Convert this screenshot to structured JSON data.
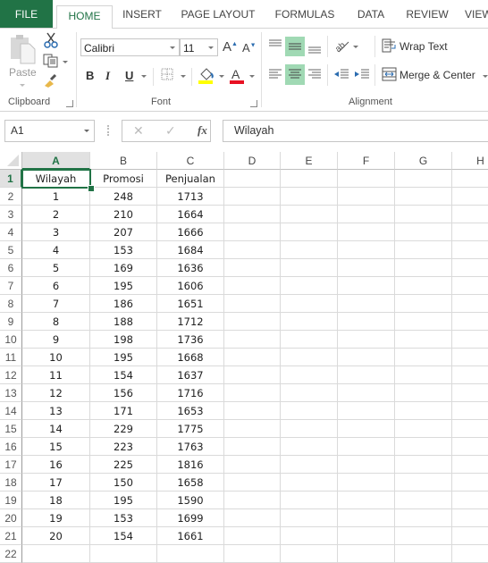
{
  "tabs": [
    {
      "label": "FILE"
    },
    {
      "label": "HOME"
    },
    {
      "label": "INSERT"
    },
    {
      "label": "PAGE LAYOUT"
    },
    {
      "label": "FORMULAS"
    },
    {
      "label": "DATA"
    },
    {
      "label": "REVIEW"
    },
    {
      "label": "VIEW"
    }
  ],
  "ribbon": {
    "clipboard": {
      "label": "Clipboard",
      "paste_label": "Paste"
    },
    "font": {
      "label": "Font",
      "font_name": "Calibri",
      "font_size": "11",
      "bold": "B",
      "italic": "I",
      "underline": "U",
      "fill_color": "#ffff00",
      "font_color": "#e81123"
    },
    "alignment": {
      "label": "Alignment",
      "wrap_text": "Wrap Text",
      "merge_center": "Merge & Center",
      "active_color": "#a0d9b4"
    }
  },
  "formula_bar": {
    "name_box": "A1",
    "fx": "fx",
    "content": "Wilayah"
  },
  "sheet": {
    "columns": [
      "A",
      "B",
      "C",
      "D",
      "E",
      "F",
      "G",
      "H"
    ],
    "selected_cell": "A1",
    "headers": [
      "Wilayah",
      "Promosi",
      "Penjualan"
    ],
    "rows": [
      [
        "1",
        "248",
        "1713"
      ],
      [
        "2",
        "210",
        "1664"
      ],
      [
        "3",
        "207",
        "1666"
      ],
      [
        "4",
        "153",
        "1684"
      ],
      [
        "5",
        "169",
        "1636"
      ],
      [
        "6",
        "195",
        "1606"
      ],
      [
        "7",
        "186",
        "1651"
      ],
      [
        "8",
        "188",
        "1712"
      ],
      [
        "9",
        "198",
        "1736"
      ],
      [
        "10",
        "195",
        "1668"
      ],
      [
        "11",
        "154",
        "1637"
      ],
      [
        "12",
        "156",
        "1716"
      ],
      [
        "13",
        "171",
        "1653"
      ],
      [
        "14",
        "229",
        "1775"
      ],
      [
        "15",
        "223",
        "1763"
      ],
      [
        "16",
        "225",
        "1816"
      ],
      [
        "17",
        "150",
        "1658"
      ],
      [
        "18",
        "195",
        "1590"
      ],
      [
        "19",
        "153",
        "1699"
      ],
      [
        "20",
        "154",
        "1661"
      ]
    ],
    "row_numbers": [
      "1",
      "2",
      "3",
      "4",
      "5",
      "6",
      "7",
      "8",
      "9",
      "10",
      "11",
      "12",
      "13",
      "14",
      "15",
      "16",
      "17",
      "18",
      "19",
      "20",
      "21",
      "22"
    ]
  }
}
